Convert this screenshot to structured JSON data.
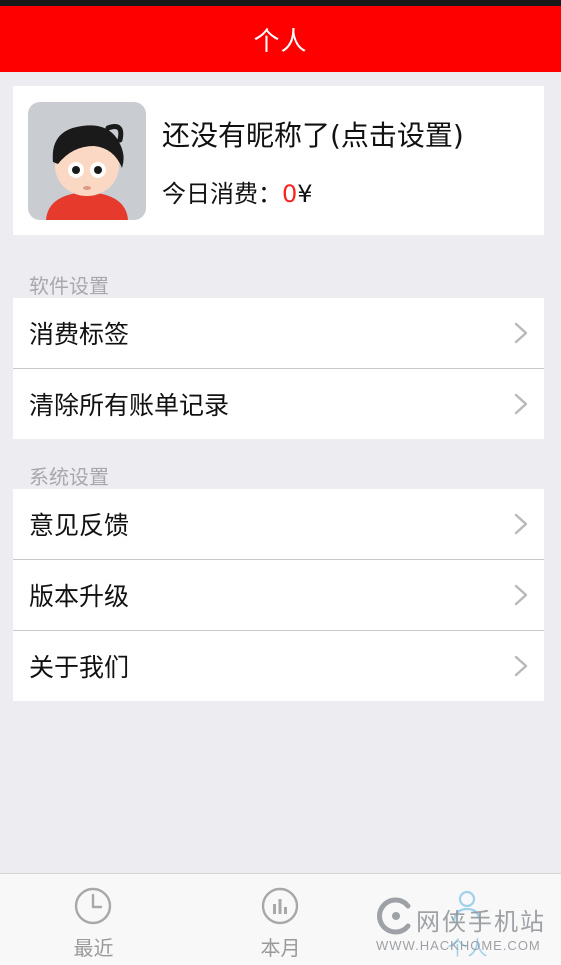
{
  "header": {
    "title": "个人"
  },
  "profile": {
    "nickname": "还没有昵称了(点击设置)",
    "today_label": "今日消费：",
    "today_amount": "0",
    "currency": "¥",
    "avatar_icon": "cartoon-boy-avatar"
  },
  "sections": [
    {
      "label": "软件设置",
      "items": [
        {
          "label": "消费标签"
        },
        {
          "label": "清除所有账单记录"
        }
      ]
    },
    {
      "label": "系统设置",
      "items": [
        {
          "label": "意见反馈"
        },
        {
          "label": "版本升级"
        },
        {
          "label": "关于我们"
        }
      ]
    }
  ],
  "tabbar": {
    "tabs": [
      {
        "label": "最近",
        "icon": "clock-icon"
      },
      {
        "label": "本月",
        "icon": "bar-chart-icon"
      },
      {
        "label": "个人",
        "icon": "person-icon"
      }
    ]
  },
  "watermark": {
    "cn": "网侠手机站",
    "en": "WWW.HACKHOME.COM"
  },
  "colors": {
    "accent": "#ff0000",
    "amount": "#ff2020",
    "background": "#ececf1",
    "section_label": "#a8a8ad",
    "tab_label": "#9a9a9a"
  }
}
